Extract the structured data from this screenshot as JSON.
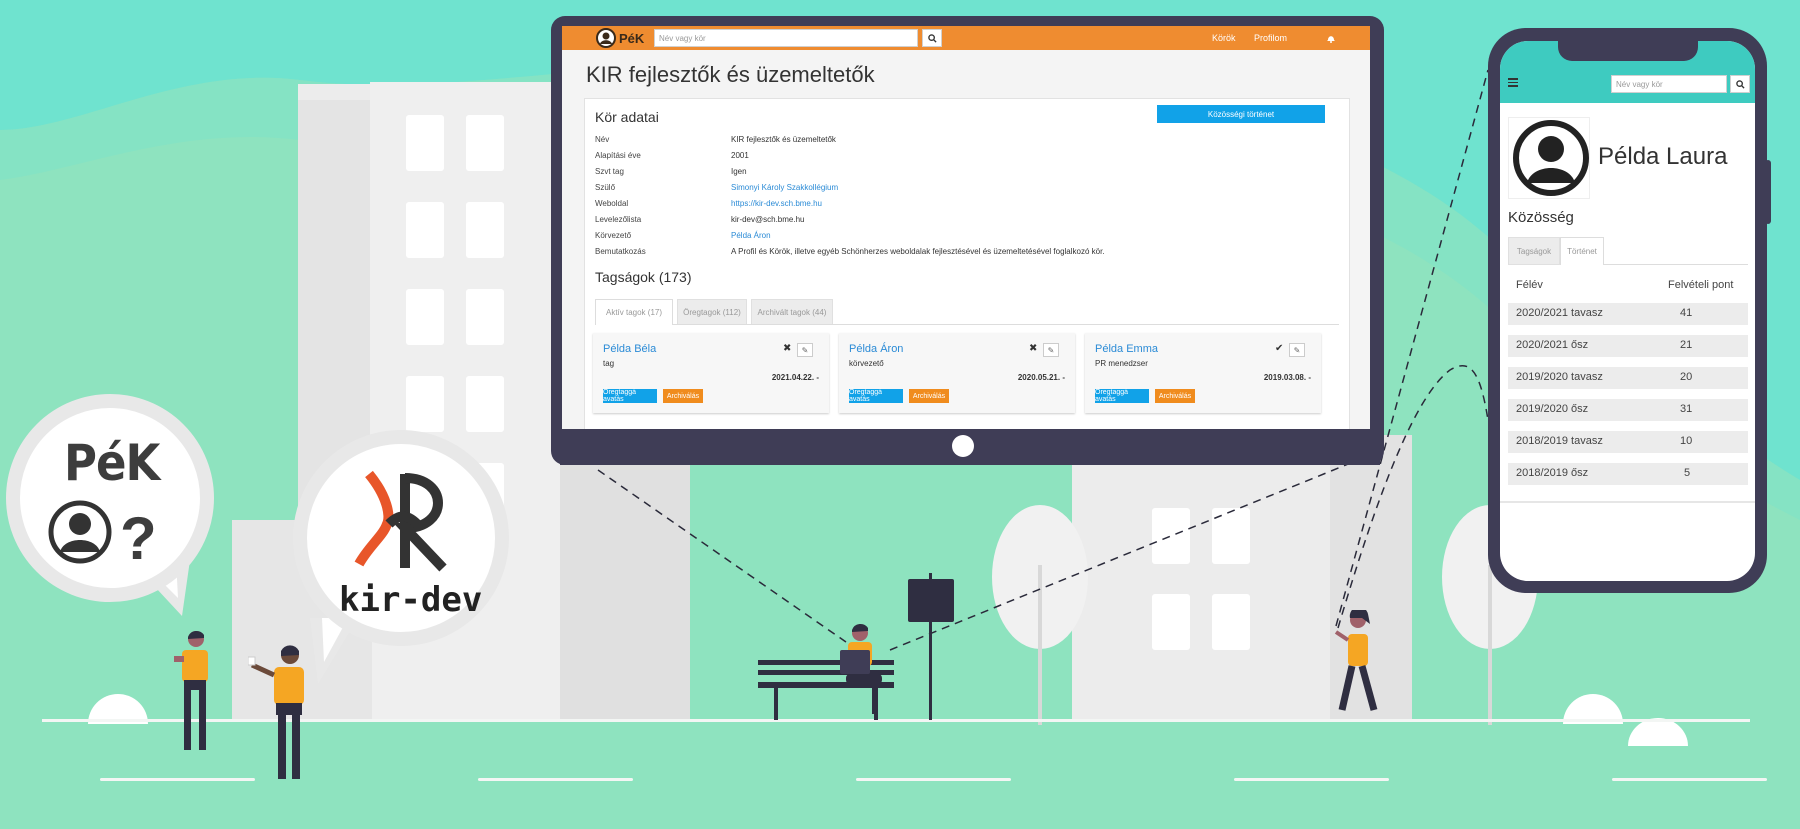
{
  "colors": {
    "background_top": "#6fe3cf",
    "ground": "#8ee3bf",
    "orange": "#ef8c30",
    "blue": "#11a2e8",
    "device": "#3f3d56",
    "teal": "#3ecbc0"
  },
  "bubbles": {
    "pek": {
      "logo_text": "PéK",
      "question_mark": "?"
    },
    "kirdev": {
      "logo_text": "kir-dev"
    }
  },
  "desktop": {
    "header": {
      "logo": "PéK",
      "search_placeholder": "Név vagy kör",
      "search_icon": "search-icon",
      "nav": [
        "Körök",
        "Profilom"
      ],
      "bell_icon": "bell-icon"
    },
    "page_title": "KIR fejlesztők és üzemeltetők",
    "details": {
      "heading": "Kör adatai",
      "history_button": "Közösségi történet",
      "rows": [
        {
          "label": "Név",
          "value": "KIR fejlesztők és üzemeltetők"
        },
        {
          "label": "Alapítási éve",
          "value": "2001"
        },
        {
          "label": "Szvt tag",
          "value": "Igen"
        },
        {
          "label": "Szülő",
          "value": "Simonyi Károly Szakkollégium"
        },
        {
          "label": "Weboldal",
          "value": "https://kir-dev.sch.bme.hu"
        },
        {
          "label": "Levelezőlista",
          "value": "kir-dev@sch.bme.hu"
        },
        {
          "label": "Körvezető",
          "value": "Példa Áron"
        },
        {
          "label": "Bemutatkozás",
          "value": "A Profil és Körök, illetve egyéb Schönherzes weboldalak fejlesztésével és üzemeltetésével foglalkozó kör."
        }
      ]
    },
    "memberships": {
      "heading": "Tagságok (173)",
      "tabs": [
        "Aktív tagok (17)",
        "Öregtagok (112)",
        "Archivált tagok (44)"
      ],
      "members": [
        {
          "name": "Példa Béla",
          "role": "tag",
          "date": "2021.04.22. -",
          "status_icon": "close-icon"
        },
        {
          "name": "Példa Áron",
          "role": "körvezető",
          "date": "2020.05.21. -",
          "status_icon": "close-icon"
        },
        {
          "name": "Példa Emma",
          "role": "PR menedzser",
          "date": "2019.03.08. -",
          "status_icon": "check-icon"
        }
      ],
      "button_oldmember": "Öregtaggá avatás",
      "button_archive": "Archiválás"
    }
  },
  "mobile": {
    "menu_icon": "hamburger-icon",
    "search_placeholder": "Név vagy kör",
    "profile_name": "Példa Laura",
    "section_title": "Közösség",
    "tabs": [
      "Tagságok",
      "Történet"
    ],
    "table_headers": [
      "Félév",
      "Felvételi pont"
    ],
    "rows": [
      {
        "semester": "2020/2021 tavasz",
        "points": "41"
      },
      {
        "semester": "2020/2021 ősz",
        "points": "21"
      },
      {
        "semester": "2019/2020 tavasz",
        "points": "20"
      },
      {
        "semester": "2019/2020 ősz",
        "points": "31"
      },
      {
        "semester": "2018/2019 tavasz",
        "points": "10"
      },
      {
        "semester": "2018/2019 ősz",
        "points": "5"
      }
    ]
  }
}
